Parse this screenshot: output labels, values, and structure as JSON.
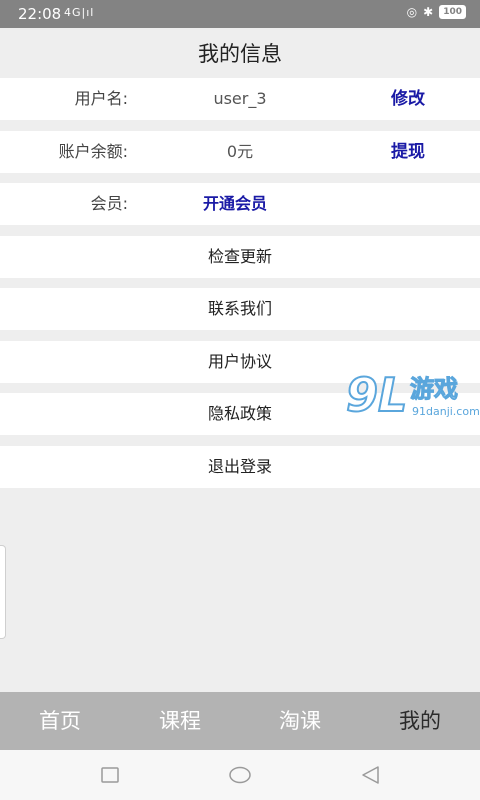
{
  "status_bar": {
    "time": "22:08",
    "signal_text": "4G|ıl",
    "battery": "100"
  },
  "header": {
    "title": "我的信息"
  },
  "profile": {
    "username_label": "用户名:",
    "username_value": "user_3",
    "username_action": "修改",
    "balance_label": "账户余额:",
    "balance_value": "0元",
    "balance_action": "提现",
    "member_label": "会员:",
    "member_action": "开通会员"
  },
  "menu": {
    "check_update": "检查更新",
    "contact_us": "联系我们",
    "user_agreement": "用户协议",
    "privacy_policy": "隐私政策",
    "logout": "退出登录"
  },
  "watermark": {
    "logo_number": "9L",
    "logo_text": "游戏",
    "site": "91danji.com"
  },
  "tabs": {
    "home": "首页",
    "courses": "课程",
    "taoke": "淘课",
    "mine": "我的"
  },
  "colors": {
    "accent_link": "#1a1aa6",
    "tab_bar": "#b3b3b3",
    "status_bar": "#838383"
  }
}
